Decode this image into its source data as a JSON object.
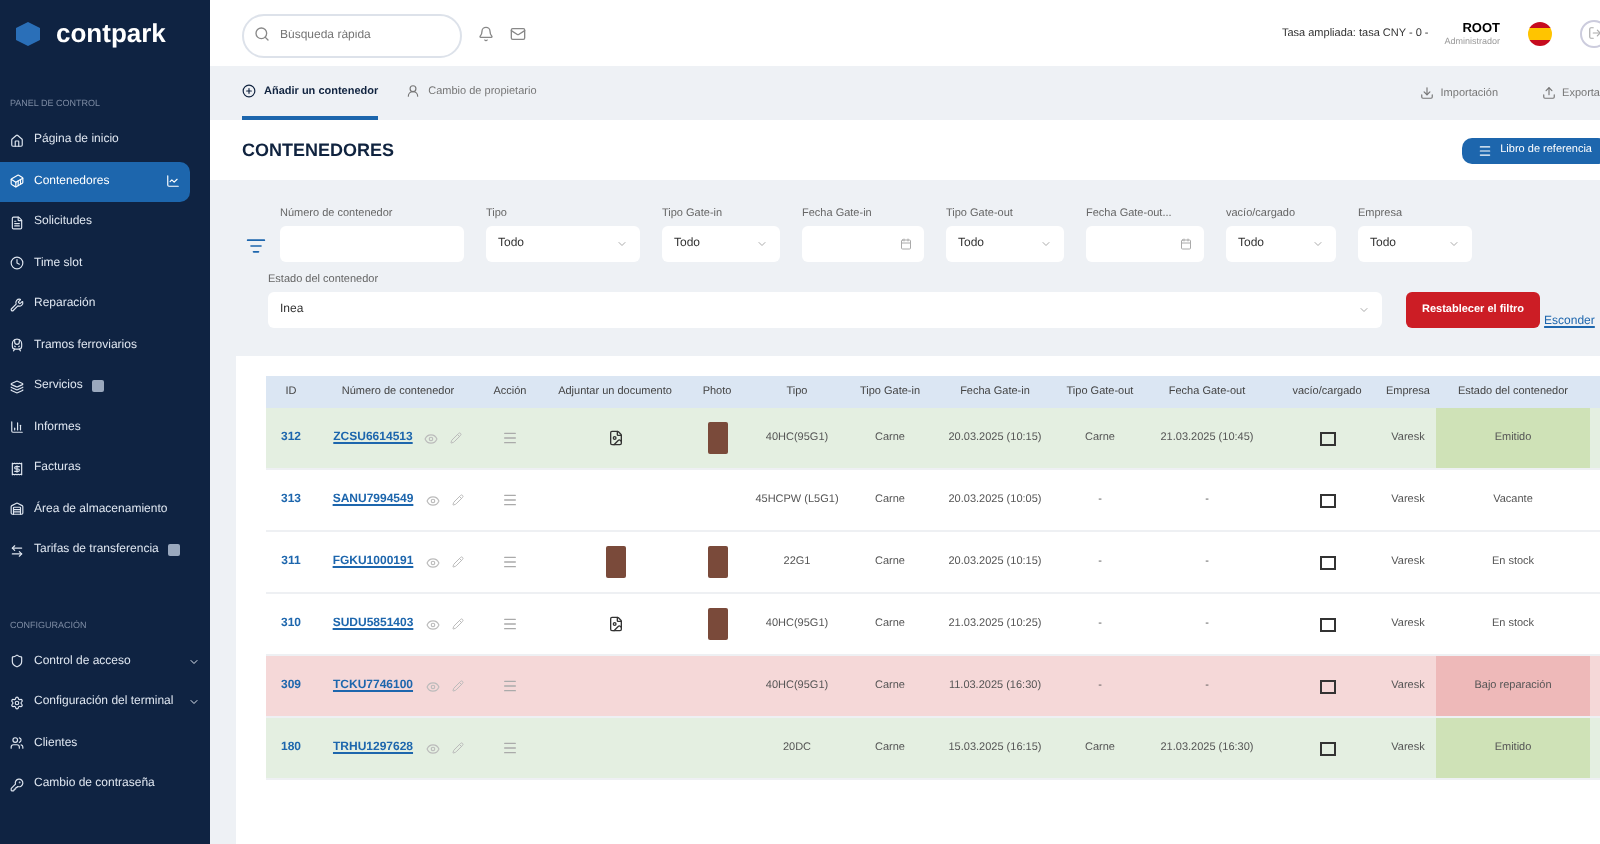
{
  "sidebar": {
    "logo": "contpark",
    "sections": [
      {
        "title": "PANEL DE CONTROL",
        "items": [
          {
            "label": "Página de inicio",
            "selected": false,
            "badge": false,
            "expandable": false
          },
          {
            "label": "Contenedores",
            "selected": true,
            "badge": false,
            "expandable": false
          },
          {
            "label": "Solicitudes",
            "selected": false,
            "badge": false,
            "expandable": false
          },
          {
            "label": "Time slot",
            "selected": false,
            "badge": false,
            "expandable": false
          },
          {
            "label": "Reparación",
            "selected": false,
            "badge": false,
            "expandable": false
          },
          {
            "label": "Tramos ferroviarios",
            "selected": false,
            "badge": false,
            "expandable": false
          },
          {
            "label": "Servicios",
            "selected": false,
            "badge": true,
            "expandable": false
          },
          {
            "label": "Informes",
            "selected": false,
            "badge": false,
            "expandable": false
          },
          {
            "label": "Facturas",
            "selected": false,
            "badge": false,
            "expandable": false
          },
          {
            "label": "Área de almacenamiento",
            "selected": false,
            "badge": false,
            "expandable": false
          },
          {
            "label": "Tarifas de transferencia",
            "selected": false,
            "badge": true,
            "expandable": false
          }
        ]
      },
      {
        "title": "CONFIGURACIÓN",
        "items": [
          {
            "label": "Control de acceso",
            "selected": false,
            "badge": false,
            "expandable": true
          },
          {
            "label": "Configuración del terminal",
            "selected": false,
            "badge": false,
            "expandable": true
          },
          {
            "label": "Clientes",
            "selected": false,
            "badge": false,
            "expandable": false
          },
          {
            "label": "Cambio de contraseña",
            "selected": false,
            "badge": false,
            "expandable": false
          }
        ]
      }
    ]
  },
  "topbar": {
    "search": {
      "placeholder": "Búsqueda rápida"
    },
    "rate": "Tasa ampliada: tasa CNY - 0 -",
    "user": {
      "name": "ROOT",
      "role": "Administrador"
    }
  },
  "tabs": [
    {
      "label": "Añadir un contenedor",
      "selected": true
    },
    {
      "label": "Cambio de propietario",
      "selected": false
    }
  ],
  "actions": [
    "Importación",
    "Exporta"
  ],
  "title": "CONTENEDORES",
  "reference_button": "Libro de referencia",
  "filters": [
    {
      "label": "Número de contenedor",
      "kind": "text"
    },
    {
      "label": "Tipo",
      "kind": "select",
      "value": "Todo"
    },
    {
      "label": "Tipo Gate-in",
      "kind": "select",
      "value": "Todo"
    },
    {
      "label": "Fecha Gate-in",
      "kind": "date"
    },
    {
      "label": "Tipo Gate-out",
      "kind": "select",
      "value": "Todo"
    },
    {
      "label": "Fecha Gate-out...",
      "kind": "date"
    },
    {
      "label": "vacío/cargado",
      "kind": "select",
      "value": "Todo"
    },
    {
      "label": "Empresa",
      "kind": "select",
      "value": "Todo"
    }
  ],
  "status_filter": {
    "label": "Estado del contenedor",
    "value": "Inea"
  },
  "reset_button": "Restablecer el filtro",
  "hide_link": "Esconder",
  "table": {
    "columns": [
      "ID",
      "Número de contenedor",
      "Acción",
      "Adjuntar un documento",
      "Photo",
      "Tipo",
      "Tipo Gate-in",
      "Fecha Gate-in",
      "Tipo Gate-out",
      "Fecha Gate-out",
      "vacío/cargado",
      "Empresa",
      "Estado del contenedor"
    ],
    "rows": [
      {
        "id": "312",
        "number": "ZCSU6614513",
        "attachment": {
          "kind": "document"
        },
        "photo": true,
        "type": "40HC(95G1)",
        "gate_in_type": "Carne",
        "gate_in_date": "20.03.2025 (10:15)",
        "gate_out_type": "Carne",
        "gate_out_date": "21.03.2025 (10:45)",
        "checked": false,
        "company": "Varesk",
        "status": "Emitido",
        "kind": "issued"
      },
      {
        "id": "313",
        "number": "SANU7994549",
        "photo": false,
        "type": "45HCPW (L5G1)",
        "gate_in_type": "Carne",
        "gate_in_date": "20.03.2025 (10:05)",
        "gate_out_type": "-",
        "gate_out_date": "-",
        "checked": false,
        "company": "Varesk",
        "status": "Vacante",
        "kind": "plain"
      },
      {
        "id": "311",
        "number": "FGKU1000191",
        "attachment": {
          "kind": "photo"
        },
        "photo": true,
        "type": "22G1",
        "gate_in_type": "Carne",
        "gate_in_date": "20.03.2025 (10:15)",
        "gate_out_type": "-",
        "gate_out_date": "-",
        "checked": false,
        "company": "Varesk",
        "status": "En stock",
        "kind": "plain"
      },
      {
        "id": "310",
        "number": "SUDU5851403",
        "attachment": {
          "kind": "document"
        },
        "photo": true,
        "type": "40HC(95G1)",
        "gate_in_type": "Carne",
        "gate_in_date": "21.03.2025 (10:25)",
        "gate_out_type": "-",
        "gate_out_date": "-",
        "checked": false,
        "company": "Varesk",
        "status": "En stock",
        "kind": "plain"
      },
      {
        "id": "309",
        "number": "TCKU7746100",
        "photo": false,
        "type": "40HC(95G1)",
        "gate_in_type": "Carne",
        "gate_in_date": "11.03.2025 (16:30)",
        "gate_out_type": "-",
        "gate_out_date": "-",
        "checked": false,
        "company": "Varesk",
        "status": "Bajo reparación",
        "kind": "repair"
      },
      {
        "id": "180",
        "number": "TRHU1297628",
        "photo": false,
        "type": "20DC",
        "gate_in_type": "Carne",
        "gate_in_date": "15.03.2025 (16:15)",
        "gate_out_type": "Carne",
        "gate_out_date": "21.03.2025 (16:30)",
        "checked": false,
        "company": "Varesk",
        "status": "Emitido",
        "kind": "issued"
      }
    ]
  }
}
